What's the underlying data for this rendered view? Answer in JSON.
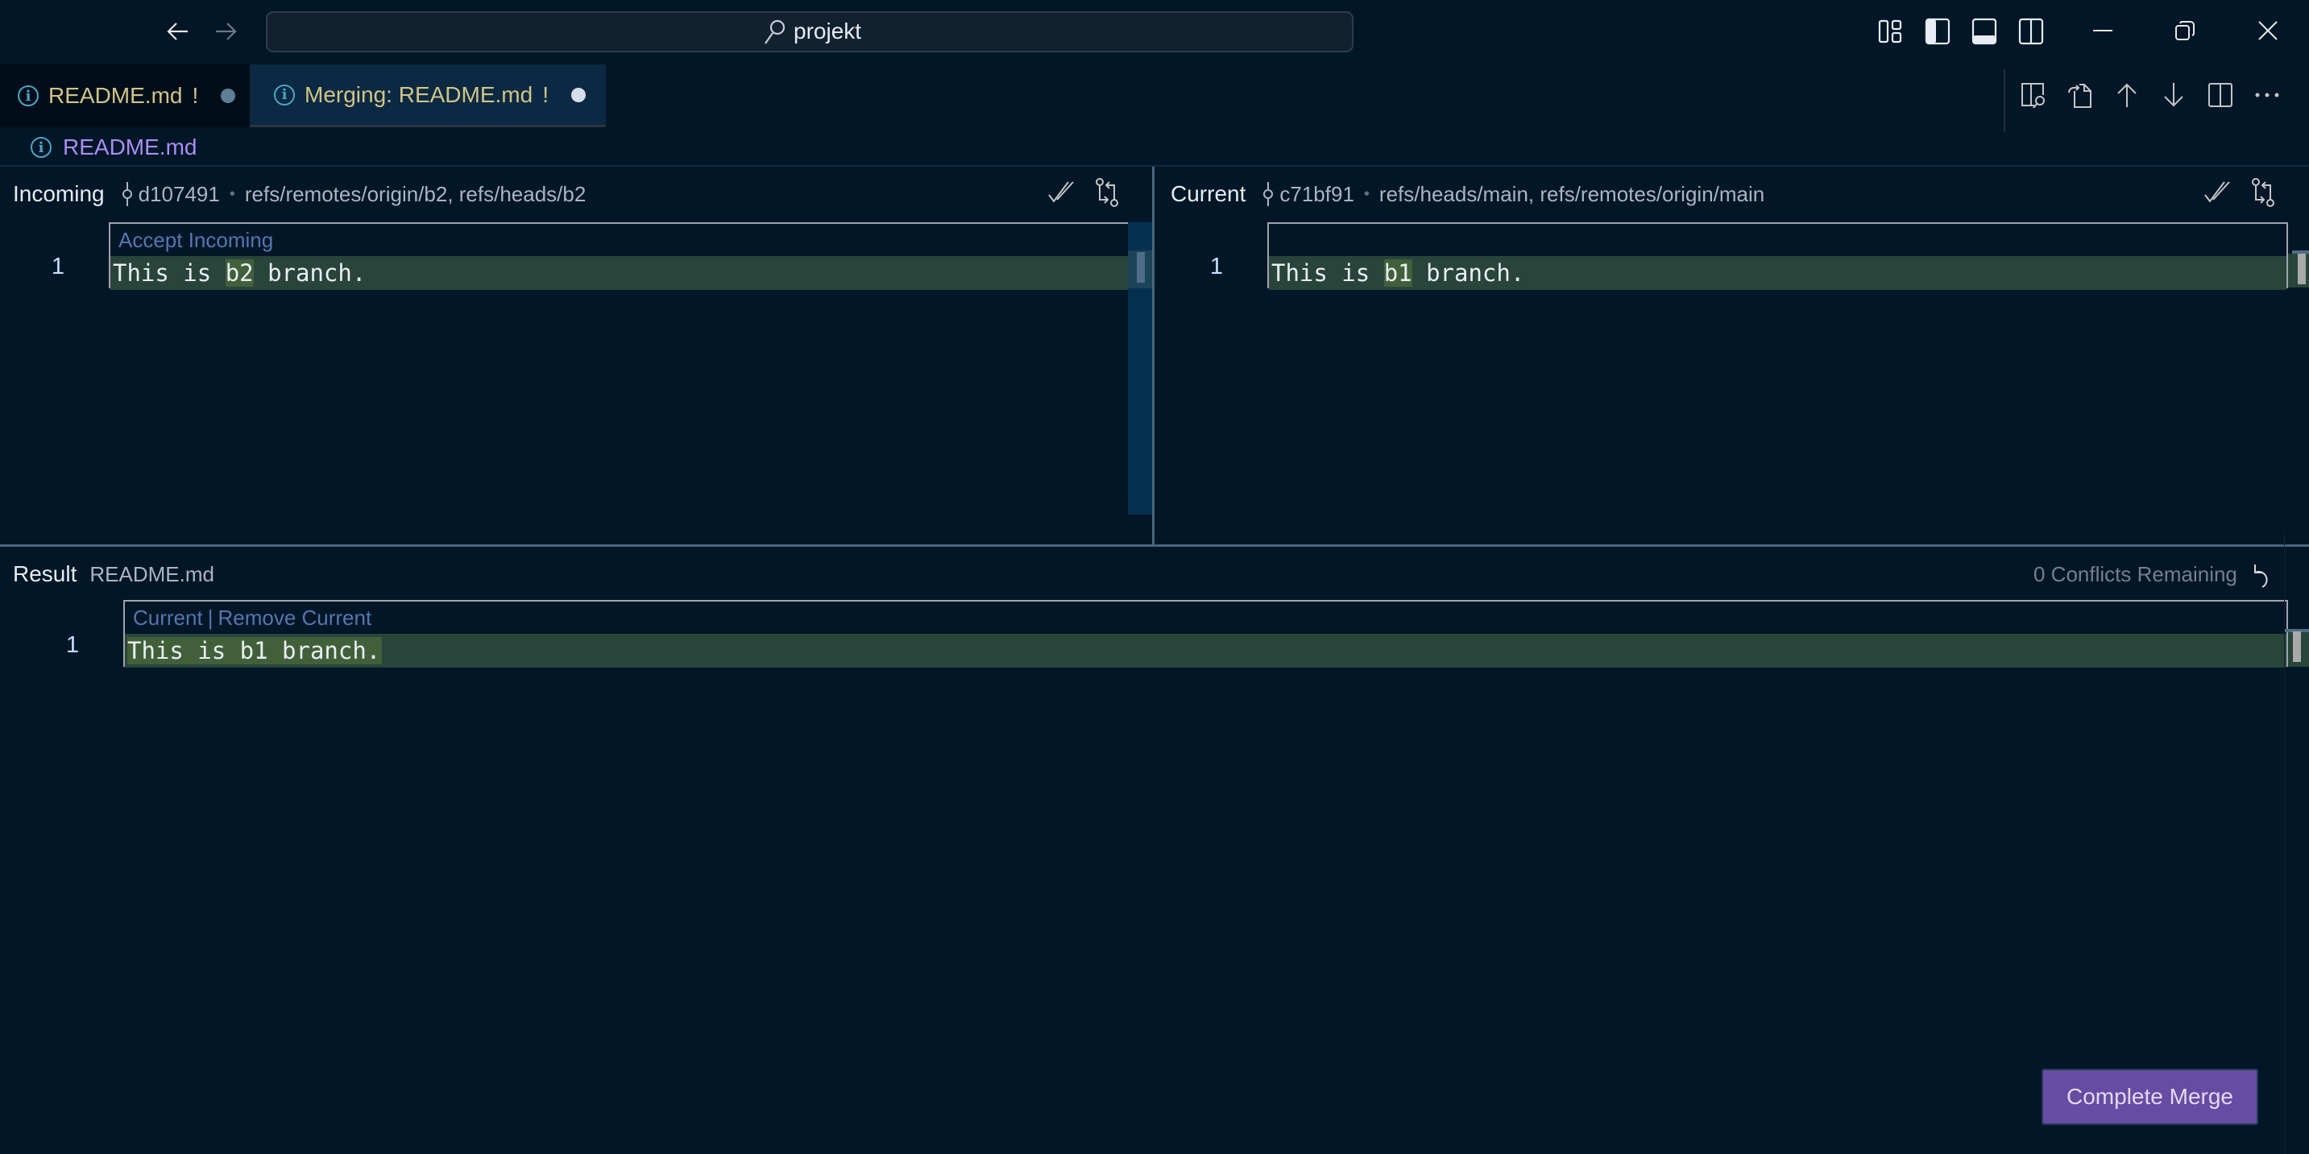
{
  "titlebar": {
    "search_text": "projekt",
    "icons": [
      "arrow-left-icon",
      "arrow-right-icon",
      "search-icon",
      "customize-layout-icon",
      "toggle-primary-sidebar-icon",
      "toggle-panel-icon",
      "toggle-secondary-sidebar-icon"
    ],
    "window_controls": [
      "minimize",
      "restore",
      "close"
    ]
  },
  "tabs": [
    {
      "label": "README.md",
      "badge": "!",
      "active": false,
      "dirty_dot_color": "#5f7e97"
    },
    {
      "label": "Merging: README.md",
      "badge": "!",
      "active": true,
      "dirty_dot_color": "#d6deeb"
    }
  ],
  "editor_actions": [
    "open-changes-icon",
    "open-file-icon",
    "previous-conflict-icon",
    "next-conflict-icon",
    "split-editor-icon",
    "more-actions-icon"
  ],
  "breadcrumb": {
    "file": "README.md"
  },
  "incoming": {
    "title": "Incoming",
    "commit": "d107491",
    "refs": "refs/remotes/origin/b2, refs/heads/b2",
    "codelens": "Accept Incoming",
    "lines": [
      {
        "number": "1",
        "before": "This is ",
        "highlight": "b2",
        "after": " branch."
      }
    ]
  },
  "current": {
    "title": "Current",
    "commit": "c71bf91",
    "refs": "refs/heads/main, refs/remotes/origin/main",
    "codelens": "",
    "lines": [
      {
        "number": "1",
        "before": "This is ",
        "highlight": "b1",
        "after": " branch."
      }
    ]
  },
  "result": {
    "title": "Result",
    "file": "README.md",
    "conflicts_remaining": "0 Conflicts Remaining",
    "codelens_current": "Current",
    "codelens_sep": "|",
    "codelens_remove": "Remove Current",
    "lines": [
      {
        "number": "1",
        "text": "This is b1 branch."
      }
    ]
  },
  "complete_merge_label": "Complete Merge",
  "colors": {
    "background": "#011627",
    "tab_label": "#d2c487",
    "breadcrumb": "#a98ef2",
    "accent_button": "#674ca3",
    "diff_line": "#29443b",
    "diff_word": "#41603a",
    "codelens": "#5576b0"
  }
}
